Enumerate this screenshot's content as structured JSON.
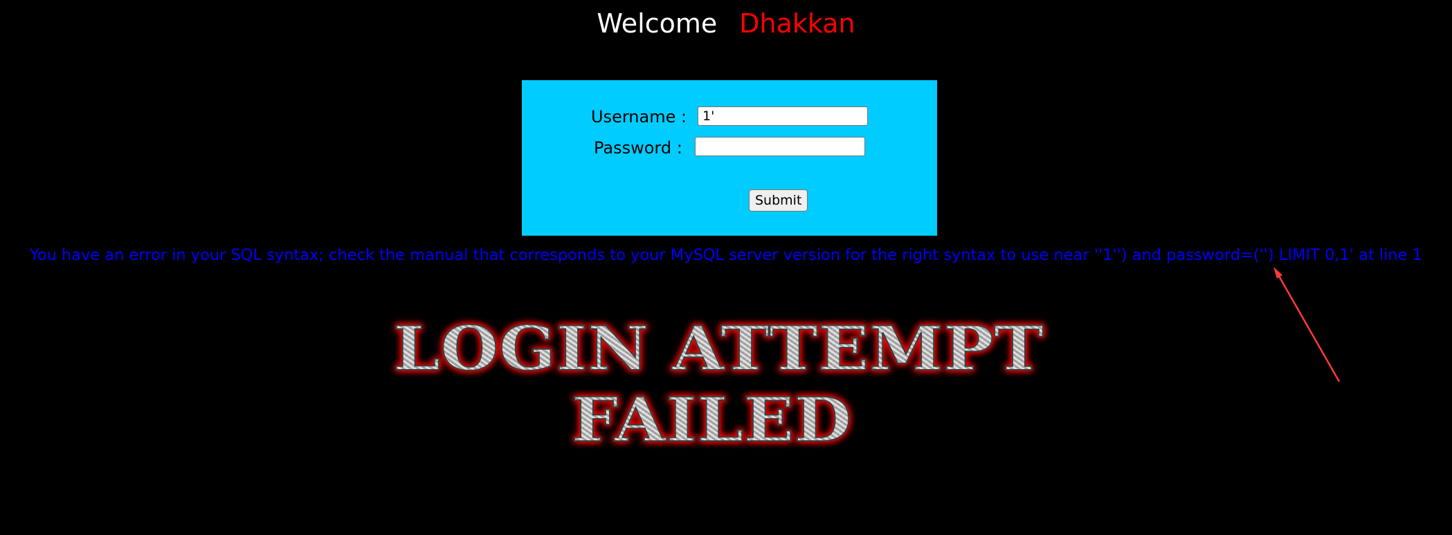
{
  "header": {
    "welcome_label": "Welcome",
    "user_name": "Dhakkan"
  },
  "login_form": {
    "username_label": "Username :",
    "username_value": "1'",
    "password_label": "Password :",
    "password_value": "",
    "submit_label": "Submit"
  },
  "error": {
    "message": "You have an error in your SQL syntax; check the manual that corresponds to your MySQL server version for the right syntax to use near ''1'') and password=('') LIMIT 0,1' at line 1"
  },
  "banner": {
    "line1": "LOGIN ATTEMPT",
    "line2": "FAILED"
  },
  "colors": {
    "background": "#000000",
    "form_background": "#00ccff",
    "welcome_text": "#ffffff",
    "user_name_text": "#ff0000",
    "error_text": "#0000ff",
    "banner_glow": "#ff0000",
    "annotation_arrow": "#ff3b3b"
  }
}
